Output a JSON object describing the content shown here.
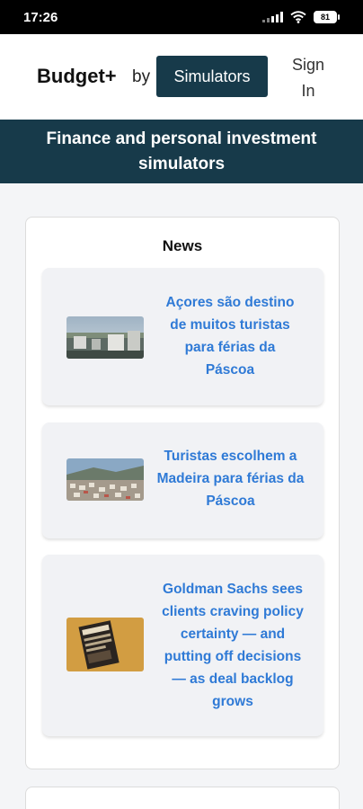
{
  "status_bar": {
    "time": "17:26",
    "battery": "81"
  },
  "header": {
    "brand": "Budget+",
    "by": "by",
    "simulators_button": "Simulators",
    "sign_in": "Sign In"
  },
  "banner": {
    "title": "Finance and personal investment simulators"
  },
  "news": {
    "title": "News",
    "items": [
      {
        "headline": "Açores são destino de muitos turistas para férias da Páscoa"
      },
      {
        "headline": "Turistas escolhem a Madeira para férias da Páscoa"
      },
      {
        "headline": "Goldman Sachs sees clients craving policy certainty — and putting off decisions — as deal backlog grows"
      }
    ]
  },
  "colors": {
    "accent": "#173a4a",
    "link": "#2f7ad6"
  }
}
